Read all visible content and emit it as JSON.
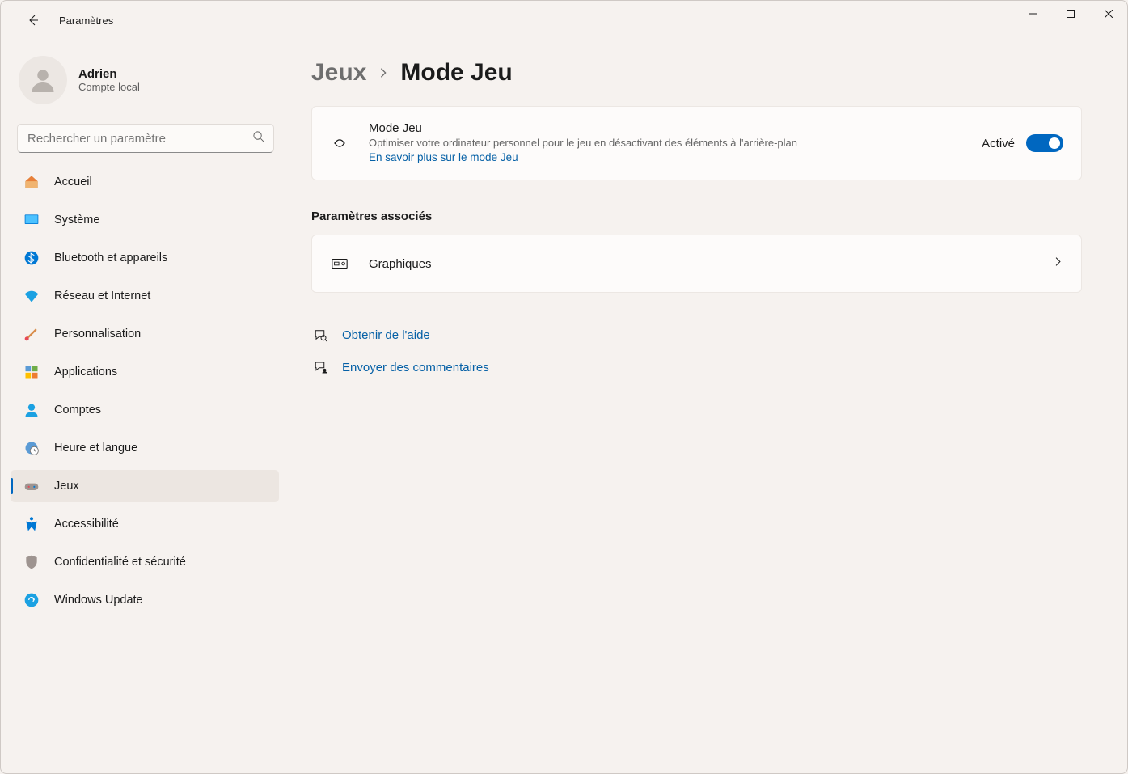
{
  "window": {
    "title": "Paramètres"
  },
  "user": {
    "name": "Adrien",
    "sub": "Compte local"
  },
  "search": {
    "placeholder": "Rechercher un paramètre"
  },
  "nav": {
    "items": [
      {
        "label": "Accueil"
      },
      {
        "label": "Système"
      },
      {
        "label": "Bluetooth et appareils"
      },
      {
        "label": "Réseau et Internet"
      },
      {
        "label": "Personnalisation"
      },
      {
        "label": "Applications"
      },
      {
        "label": "Comptes"
      },
      {
        "label": "Heure et langue"
      },
      {
        "label": "Jeux"
      },
      {
        "label": "Accessibilité"
      },
      {
        "label": "Confidentialité et sécurité"
      },
      {
        "label": "Windows Update"
      }
    ]
  },
  "breadcrumb": {
    "parent": "Jeux",
    "current": "Mode Jeu"
  },
  "gamemode": {
    "title": "Mode Jeu",
    "desc": "Optimiser votre ordinateur personnel pour le jeu en désactivant des éléments à l'arrière-plan",
    "link": "En savoir plus sur le mode Jeu",
    "state_label": "Activé"
  },
  "related": {
    "heading": "Paramètres associés",
    "graphics": "Graphiques"
  },
  "help": {
    "get_help": "Obtenir de l'aide",
    "feedback": "Envoyer des commentaires"
  }
}
